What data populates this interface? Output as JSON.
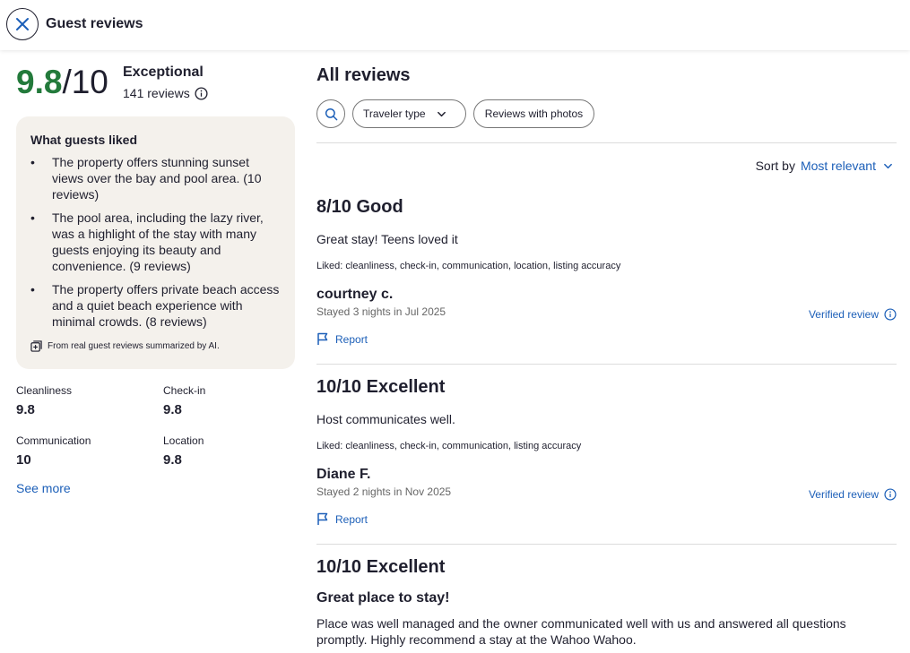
{
  "header": {
    "title": "Guest reviews"
  },
  "summary": {
    "score": "9.8",
    "out_of": "/10",
    "label": "Exceptional",
    "count": "141 reviews"
  },
  "liked": {
    "title": "What guests liked",
    "items": [
      "The property offers stunning sunset views over the bay and pool area. (10 reviews)",
      "The pool area, including the lazy river, was a highlight of the stay with many guests enjoying its beauty and convenience. (9 reviews)",
      "The property offers private beach access and a quiet beach experience with minimal crowds. (8 reviews)"
    ],
    "ai_note": "From real guest reviews summarized by AI."
  },
  "ratings": [
    {
      "label": "Cleanliness",
      "value": "9.8"
    },
    {
      "label": "Check-in",
      "value": "9.8"
    },
    {
      "label": "Communication",
      "value": "10"
    },
    {
      "label": "Location",
      "value": "9.8"
    }
  ],
  "see_more": "See more",
  "reviews_panel": {
    "title": "All reviews",
    "filters": {
      "traveler_type": "Traveler type",
      "with_photos": "Reviews with photos"
    },
    "sort": {
      "label": "Sort by",
      "value": "Most relevant"
    }
  },
  "reviews": [
    {
      "rating": "8/10 Good",
      "text": "Great stay! Teens loved it",
      "liked": "Liked: cleanliness, check-in, communication, location, listing accuracy",
      "author": "courtney c.",
      "stay": "Stayed 3 nights in Jul 2025",
      "verified": "Verified review",
      "report": "Report"
    },
    {
      "rating": "10/10 Excellent",
      "text": "Host communicates well.",
      "liked": "Liked: cleanliness, check-in, communication, listing accuracy",
      "author": "Diane F.",
      "stay": "Stayed 2 nights in Nov 2025",
      "verified": "Verified review",
      "report": "Report"
    },
    {
      "rating": "10/10 Excellent",
      "subtitle": "Great place to stay!",
      "body": "Place was well managed and the owner communicated well with us and answered all questions promptly. Highly recommend a stay at the Wahoo Wahoo."
    }
  ],
  "colors": {
    "score_green": "#237a3b",
    "link_blue": "#1c5fb8",
    "panel_bg": "#f4f1ec"
  }
}
